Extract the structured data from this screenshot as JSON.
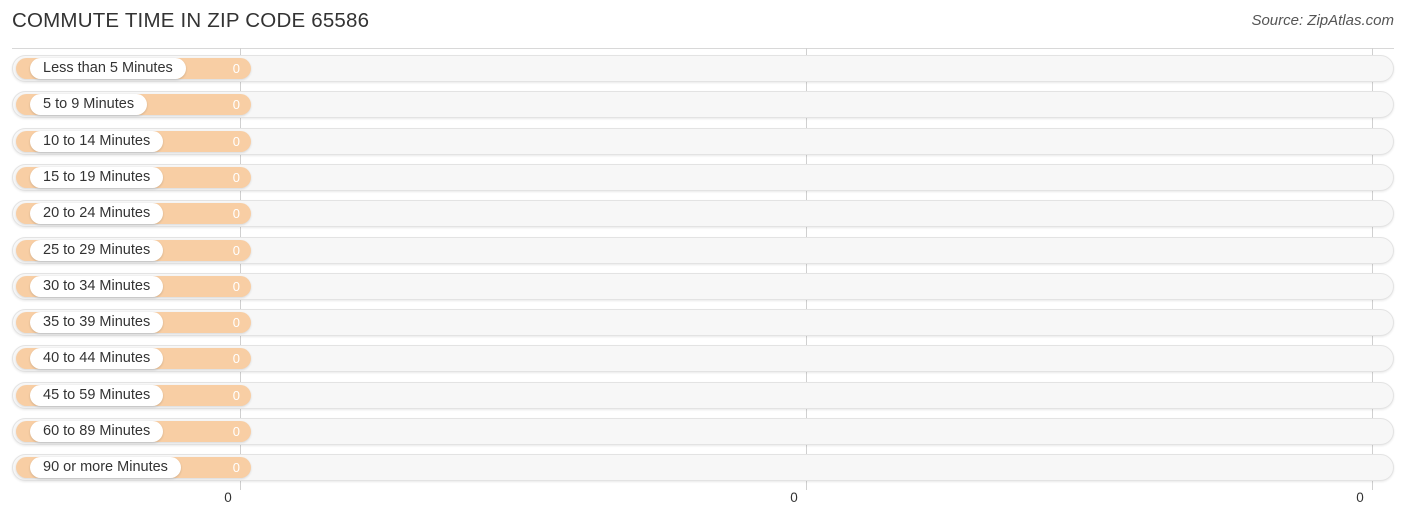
{
  "header": {
    "title": "COMMUTE TIME IN ZIP CODE 65586",
    "source": "Source: ZipAtlas.com"
  },
  "chart_data": {
    "type": "bar",
    "orientation": "horizontal",
    "title": "COMMUTE TIME IN ZIP CODE 65586",
    "xlabel": "",
    "ylabel": "",
    "xlim": [
      0,
      0
    ],
    "grid": true,
    "legend": false,
    "bar_color": "#F8CEA4",
    "track_color": "#F7F7F7",
    "categories": [
      "Less than 5 Minutes",
      "5 to 9 Minutes",
      "10 to 14 Minutes",
      "15 to 19 Minutes",
      "20 to 24 Minutes",
      "25 to 29 Minutes",
      "30 to 34 Minutes",
      "35 to 39 Minutes",
      "40 to 44 Minutes",
      "45 to 59 Minutes",
      "60 to 89 Minutes",
      "90 or more Minutes"
    ],
    "values": [
      0,
      0,
      0,
      0,
      0,
      0,
      0,
      0,
      0,
      0,
      0,
      0
    ],
    "value_labels": [
      "0",
      "0",
      "0",
      "0",
      "0",
      "0",
      "0",
      "0",
      "0",
      "0",
      "0",
      "0"
    ],
    "xticks": [
      0,
      0,
      0
    ],
    "xtick_labels": [
      "0",
      "0",
      "0"
    ]
  }
}
